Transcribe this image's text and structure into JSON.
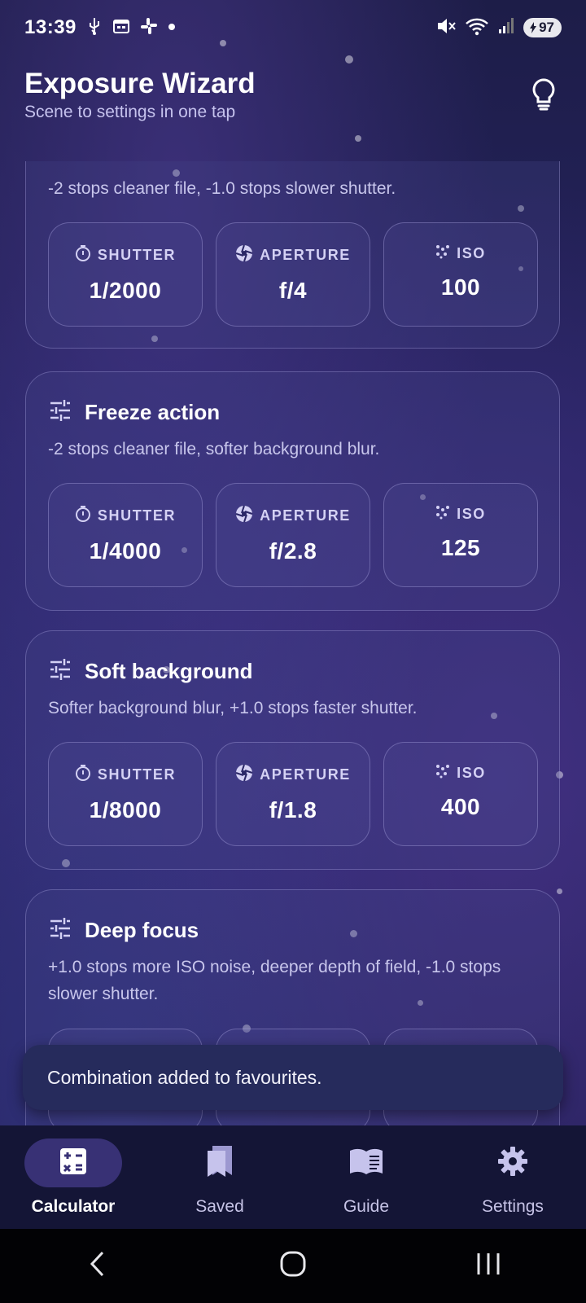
{
  "status_bar": {
    "time": "13:39",
    "battery": "97",
    "icons": [
      "usb-icon",
      "calendar-icon",
      "slack-icon",
      "dot-icon",
      "mute-icon",
      "wifi-icon",
      "signal-icon",
      "battery-icon"
    ]
  },
  "header": {
    "title": "Exposure Wizard",
    "subtitle": "Scene to settings in one tap",
    "tips_icon": "lightbulb-icon"
  },
  "labels": {
    "shutter": "SHUTTER",
    "aperture": "APERTURE",
    "iso": "ISO"
  },
  "cards": [
    {
      "title": "",
      "description": "-2 stops cleaner file, -1.0 stops slower shutter.",
      "shutter": "1/2000",
      "aperture": "f/4",
      "iso": "100"
    },
    {
      "title": "Freeze action",
      "description": "-2 stops cleaner file, softer background blur.",
      "shutter": "1/4000",
      "aperture": "f/2.8",
      "iso": "125"
    },
    {
      "title": "Soft background",
      "description": "Softer background blur, +1.0 stops faster shutter.",
      "shutter": "1/8000",
      "aperture": "f/1.8",
      "iso": "400"
    },
    {
      "title": "Deep focus",
      "description": "+1.0 stops more ISO noise, deeper depth of field, -1.0 stops slower shutter.",
      "shutter": "",
      "aperture": "",
      "iso": ""
    }
  ],
  "snackbar": {
    "message": "Combination added to favourites."
  },
  "bottom_nav": {
    "items": [
      {
        "label": "Calculator",
        "icon": "calculator-icon",
        "active": true
      },
      {
        "label": "Saved",
        "icon": "bookmark-icon",
        "active": false
      },
      {
        "label": "Guide",
        "icon": "book-icon",
        "active": false
      },
      {
        "label": "Settings",
        "icon": "gear-icon",
        "active": false
      }
    ]
  },
  "colors": {
    "background": "#272463",
    "card_border": "#aeaae6",
    "nav_background": "#141536",
    "active_pill": "#383175",
    "snackbar": "#262b5c"
  }
}
